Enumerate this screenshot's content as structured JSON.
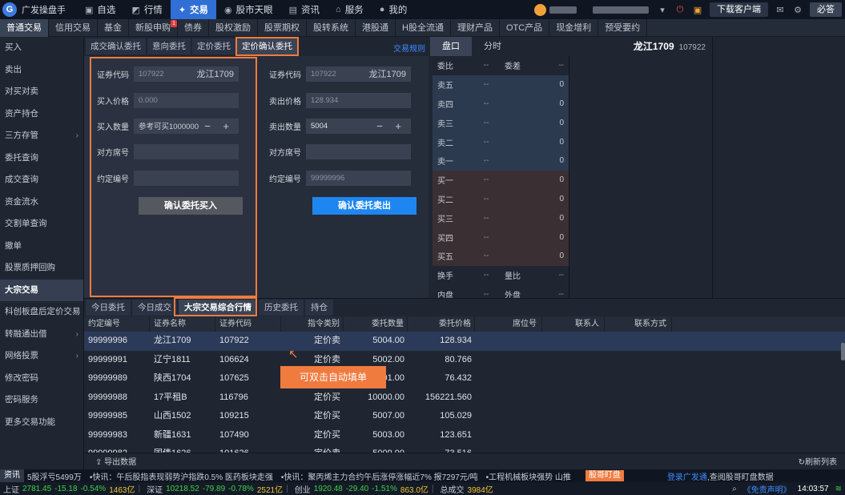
{
  "app": {
    "title": "广发操盘手"
  },
  "topnav": [
    {
      "icon": "monitor-icon",
      "glyph": "▣",
      "label": "自选"
    },
    {
      "icon": "chart-icon",
      "glyph": "◩",
      "label": "行情"
    },
    {
      "icon": "trade-icon",
      "glyph": "✦",
      "label": "交易"
    },
    {
      "icon": "eye-icon",
      "glyph": "◉",
      "label": "股市天眼"
    },
    {
      "icon": "news-icon",
      "glyph": "▤",
      "label": "资讯"
    },
    {
      "icon": "service-icon",
      "glyph": "⌂",
      "label": "服务"
    },
    {
      "icon": "user-icon",
      "glyph": "●",
      "label": "我的"
    }
  ],
  "topright": {
    "download": "下载客户端",
    "must": "必答"
  },
  "tabs": [
    "普通交易",
    "信用交易",
    "基金",
    "新股申购",
    "债券",
    "股权激励",
    "股票期权",
    "股转系统",
    "港股通",
    "H股全流通",
    "理财产品",
    "OTC产品",
    "现金增利",
    "预受要约"
  ],
  "tab_badge": "1",
  "sidebar": [
    {
      "label": "买入",
      "arrow": ""
    },
    {
      "label": "卖出",
      "arrow": ""
    },
    {
      "label": "对买对卖",
      "arrow": ""
    },
    {
      "label": "资产持仓",
      "arrow": ""
    },
    {
      "label": "三方存管",
      "arrow": "›"
    },
    {
      "label": "委托查询",
      "arrow": ""
    },
    {
      "label": "成交查询",
      "arrow": ""
    },
    {
      "label": "资金流水",
      "arrow": ""
    },
    {
      "label": "交割单查询",
      "arrow": ""
    },
    {
      "label": "撤单",
      "arrow": ""
    },
    {
      "label": "股票质押回购",
      "arrow": ""
    },
    {
      "label": "大宗交易",
      "arrow": ""
    },
    {
      "label": "科创板盘后定价交易",
      "arrow": ""
    },
    {
      "label": "转融通出借",
      "arrow": "›"
    },
    {
      "label": "网络投票",
      "arrow": "›"
    },
    {
      "label": "修改密码",
      "arrow": ""
    },
    {
      "label": "密码服务",
      "arrow": ""
    },
    {
      "label": "更多交易功能",
      "arrow": ""
    }
  ],
  "subtabs": [
    "成交确认委托",
    "意向委托",
    "定价委托",
    "定价确认委托"
  ],
  "rules_link": "交易规则",
  "buy": {
    "code_label": "证券代码",
    "code": "107922",
    "name": "龙江1709",
    "price_label": "买入价格",
    "price_ph": "0.000",
    "qty_label": "买入数量",
    "qty_ph": "参考可买1000000",
    "seat_label": "对方席号",
    "contract_label": "约定编号",
    "button": "确认委托买入"
  },
  "sell": {
    "code_label": "证券代码",
    "code": "107922",
    "name": "龙江1709",
    "price_label": "卖出价格",
    "price": "128.934",
    "qty_label": "卖出数量",
    "qty": "5004",
    "seat_label": "对方席号",
    "contract_label": "约定编号",
    "contract": "99999996",
    "button": "确认委托卖出"
  },
  "stepper": "−  +",
  "panel": {
    "tabs": [
      "盘口",
      "分时"
    ],
    "stock_name": "龙江1709",
    "stock_code": "107922"
  },
  "book": {
    "head": [
      {
        "label": "委比",
        "v": "--"
      },
      {
        "label": "委差",
        "v": "--"
      }
    ],
    "sells": [
      {
        "label": "卖五",
        "price": "--",
        "vol": "0"
      },
      {
        "label": "卖四",
        "price": "--",
        "vol": "0"
      },
      {
        "label": "卖三",
        "price": "--",
        "vol": "0"
      },
      {
        "label": "卖二",
        "price": "--",
        "vol": "0"
      },
      {
        "label": "卖一",
        "price": "--",
        "vol": "0"
      }
    ],
    "buys": [
      {
        "label": "买一",
        "price": "--",
        "vol": "0"
      },
      {
        "label": "买二",
        "price": "--",
        "vol": "0"
      },
      {
        "label": "买三",
        "price": "--",
        "vol": "0"
      },
      {
        "label": "买四",
        "price": "--",
        "vol": "0"
      },
      {
        "label": "买五",
        "price": "--",
        "vol": "0"
      }
    ],
    "foot": [
      {
        "a": "换手",
        "av": "--",
        "b": "量比",
        "bv": "--"
      },
      {
        "a": "内盘",
        "av": "--",
        "b": "外盘",
        "bv": "--"
      }
    ]
  },
  "bottom_tabs": [
    "今日委托",
    "今日成交",
    "大宗交易综合行情",
    "历史委托",
    "持仓"
  ],
  "table": {
    "headers": [
      "约定编号",
      "证券名称",
      "证券代码",
      "指令类别",
      "委托数量",
      "委托价格",
      "席位号",
      "联系人",
      "联系方式"
    ],
    "rows": [
      [
        "99999996",
        "龙江1709",
        "107922",
        "定价卖",
        "5004.00",
        "128.934"
      ],
      [
        "99999991",
        "辽宁1811",
        "106624",
        "定价卖",
        "5002.00",
        "80.766"
      ],
      [
        "99999989",
        "陕西1704",
        "107625",
        "定价卖",
        "5001.00",
        "76.432"
      ],
      [
        "99999988",
        "17平租B",
        "116796",
        "定价买",
        "10000.00",
        "156221.560"
      ],
      [
        "99999985",
        "山西1502",
        "109215",
        "定价买",
        "5007.00",
        "105.029"
      ],
      [
        "99999983",
        "新疆1631",
        "107490",
        "定价买",
        "5003.00",
        "123.651"
      ],
      [
        "99999982",
        "国债1626",
        "101626",
        "定价卖",
        "5009.00",
        "73.516"
      ]
    ]
  },
  "tooltip": "可双击自动填单",
  "footer": {
    "export": "导出数据",
    "refresh": "刷新列表"
  },
  "ticker": {
    "tag": "资讯",
    "items": [
      "5股浮亏5499万",
      "•快讯：午后股指表现弱势沪指跌0.5% 医药板块走强",
      "•快讯：聚丙烯主力合约午后涨停涨幅近7% 报7297元/吨",
      "•工程机械板块强势 山推"
    ],
    "hot_tag": "股哥盯盘",
    "ad_link": "登录广发通",
    "ad_text": ",查阅股哥盯盘数据"
  },
  "status": {
    "sh": {
      "label": "上证",
      "value": "2781.45",
      "chg": "-15.18",
      "pct": "-0.54%",
      "amt": "1463亿"
    },
    "sz": {
      "label": "深证",
      "value": "10218.52",
      "chg": "-79.89",
      "pct": "-0.78%",
      "amt": "2521亿"
    },
    "cy": {
      "label": "创业",
      "value": "1920.48",
      "chg": "-29.40",
      "pct": "-1.51%",
      "amt": "863.0亿"
    },
    "total": {
      "label": "总成交",
      "amt": "3984亿"
    },
    "disclaimer": "《免责声明》",
    "time": "14:03:57"
  },
  "colors": {
    "accent": "#2f6fd6",
    "highlight": "#f07b3f",
    "up": "#3cd24a",
    "sell_btn": "#1e86f0"
  }
}
